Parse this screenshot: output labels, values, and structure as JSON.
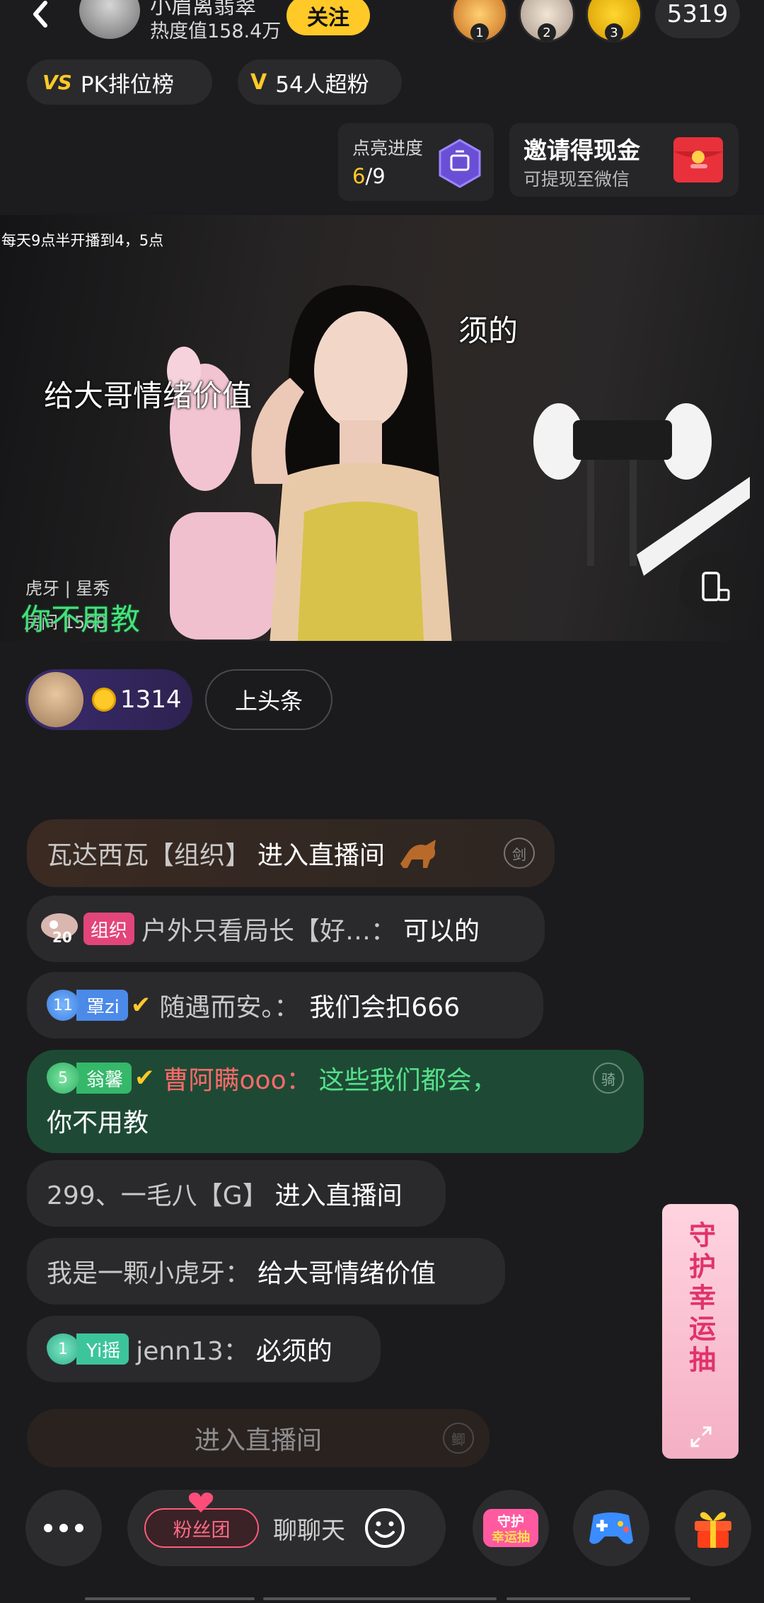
{
  "header": {
    "host_name": "小眉离翡翠",
    "heat_text": "热度值158.4万",
    "follow_label": "关注",
    "viewers": [
      {
        "rank": "1"
      },
      {
        "rank": "2"
      },
      {
        "rank": "3"
      }
    ],
    "viewer_count": "5319",
    "pk_label": "PK排位榜",
    "fans_label": "54人超粉",
    "light_progress_label": "点亮进度",
    "light_progress_current": "6",
    "light_progress_total": "/9",
    "invite_title": "邀请得现金",
    "invite_sub": "可提现至微信"
  },
  "video": {
    "schedule": "每天9点半开播到4，5点",
    "subtitle_left": "给大哥情绪价值",
    "subtitle_right": "须的",
    "platform_tag": "虎牙 | 星秀",
    "room_id": "房间 1568",
    "subtitle_bottom": "你不用教"
  },
  "ranking": {
    "coin_value": "1314",
    "headline_label": "上头条"
  },
  "chat": {
    "m1": {
      "name": "瓦达西瓦【组织】",
      "text": "进入直播间",
      "side": "剑"
    },
    "m2": {
      "badge": "组织",
      "level": "20",
      "name": "户外只看局长【好…：",
      "text": "可以的"
    },
    "m3": {
      "level": "11",
      "fan": "罩zi",
      "name": "随遇而安。：",
      "text": "我们会扣666"
    },
    "m4": {
      "level": "5",
      "fan": "翁馨",
      "name": "曹阿瞒ooo：",
      "text": "这些我们都会，",
      "text2": "你不用教",
      "side": "骑"
    },
    "m5": {
      "name": "299、一毛八【G】",
      "text": "进入直播间"
    },
    "m6": {
      "name": "我是一颗小虎牙：",
      "text": "给大哥情绪价值"
    },
    "m7": {
      "level": "1",
      "fan": "Yi摇",
      "name": "jenn13：",
      "text": "必须的"
    },
    "m8": {
      "text": "进入直播间",
      "side": "鲫"
    }
  },
  "guard": {
    "label": "守护幸运抽"
  },
  "bottom": {
    "fanclub_label": "粉丝团",
    "chat_placeholder": "聊聊天",
    "guard_icon_text": "守护幸运抽"
  },
  "colors": {
    "accent_yellow": "#ffc928",
    "guard_pink": "#e0336b",
    "chat_green": "#1e4a35",
    "highlight_green": "#55e08a"
  },
  "icons": [
    "back-icon",
    "shield-icon",
    "red-packet-icon",
    "rotate-screen-icon",
    "coin-icon",
    "more-icon",
    "emoji-icon",
    "guard-icon",
    "game-icon",
    "gift-icon",
    "expand-icon"
  ]
}
